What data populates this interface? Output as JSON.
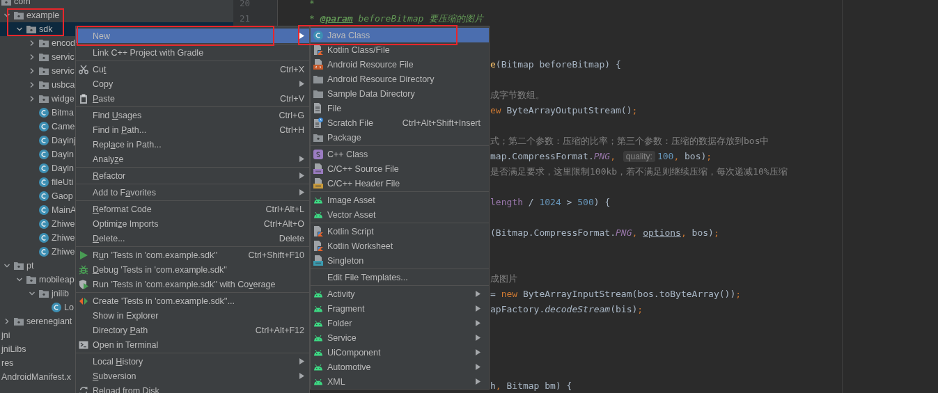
{
  "project_tree": {
    "packages": [
      {
        "label": "com",
        "kind": "package",
        "selected": false,
        "children": [
          {
            "label": "example",
            "kind": "package",
            "expanded": true,
            "selected": false,
            "outlined": true,
            "children": [
              {
                "label": "sdk",
                "kind": "package",
                "expanded": true,
                "selected": true,
                "outlined": true,
                "children": [
                  {
                    "label": "encod",
                    "kind": "package",
                    "expanded": false,
                    "selected": false
                  },
                  {
                    "label": "servic",
                    "kind": "package",
                    "expanded": false,
                    "selected": false
                  },
                  {
                    "label": "servic",
                    "kind": "package",
                    "expanded": false,
                    "selected": false
                  },
                  {
                    "label": "usbca",
                    "kind": "package",
                    "expanded": false,
                    "selected": false
                  },
                  {
                    "label": "widge",
                    "kind": "package",
                    "expanded": false,
                    "selected": false
                  },
                  {
                    "label": "Bitma",
                    "kind": "class",
                    "selected": false
                  },
                  {
                    "label": "Came",
                    "kind": "class",
                    "selected": false
                  },
                  {
                    "label": "Dayinj",
                    "kind": "class",
                    "selected": false
                  },
                  {
                    "label": "Dayin",
                    "kind": "class",
                    "selected": false
                  },
                  {
                    "label": "Dayin",
                    "kind": "class",
                    "selected": false
                  },
                  {
                    "label": "fileUti",
                    "kind": "class",
                    "selected": false
                  },
                  {
                    "label": "Gaop",
                    "kind": "class",
                    "selected": false
                  },
                  {
                    "label": "MainA",
                    "kind": "class",
                    "selected": false
                  },
                  {
                    "label": "Zhiwe",
                    "kind": "class",
                    "selected": false
                  },
                  {
                    "label": "Zhiwe",
                    "kind": "class",
                    "selected": false
                  },
                  {
                    "label": "Zhiwe",
                    "kind": "class",
                    "selected": false
                  }
                ]
              }
            ]
          },
          {
            "label": "pt",
            "kind": "package",
            "expanded": true,
            "selected": false,
            "children": [
              {
                "label": "mobileap",
                "kind": "package",
                "expanded": true,
                "selected": false,
                "children": [
                  {
                    "label": "jnilib",
                    "kind": "package",
                    "expanded": true,
                    "selected": false,
                    "children": [
                      {
                        "label": "Lo",
                        "kind": "class",
                        "selected": false
                      }
                    ]
                  }
                ]
              }
            ]
          },
          {
            "label": "serenegiant",
            "kind": "package",
            "expanded": false,
            "selected": false
          }
        ]
      }
    ],
    "module_items": [
      {
        "label": "jni",
        "selected": false
      },
      {
        "label": "jniLibs",
        "selected": false
      },
      {
        "label": "res",
        "selected": false
      },
      {
        "label": "AndroidManifest.x",
        "selected": false
      }
    ]
  },
  "editor": {
    "line_numbers": [
      "20",
      "21"
    ],
    "top_lines": [
      {
        "kind": "code",
        "tokens": [
          {
            "kind": "doc",
            "text": "*"
          }
        ]
      },
      {
        "kind": "code",
        "tokens": [
          {
            "kind": "doc",
            "text": "* "
          },
          {
            "kind": "doc-tag",
            "text": "@param"
          },
          {
            "kind": "doc",
            "text": " beforeBitmap 要压缩的图片"
          }
        ]
      }
    ],
    "lines": [
      {
        "kind": "blank"
      },
      {
        "kind": "blank"
      },
      {
        "kind": "code",
        "tokens": [
          {
            "kind": "method",
            "text": "e"
          },
          {
            "kind": "plain",
            "text": "(Bitmap beforeBitmap) {"
          }
        ]
      },
      {
        "kind": "blank"
      },
      {
        "kind": "code",
        "tokens": [
          {
            "kind": "comment",
            "text": "成字节数组。"
          }
        ]
      },
      {
        "kind": "code",
        "tokens": [
          {
            "kind": "keyword",
            "text": "ew"
          },
          {
            "kind": "plain",
            "text": " ByteArrayOutputStream()"
          },
          {
            "kind": "keyword",
            "text": ";"
          }
        ]
      },
      {
        "kind": "blank"
      },
      {
        "kind": "code",
        "tokens": [
          {
            "kind": "comment",
            "text": "式；第二个参数：压缩的比率；第三个参数：压缩的数据存放到bos中"
          }
        ]
      },
      {
        "kind": "code",
        "tokens": [
          {
            "kind": "plain",
            "text": "map.CompressFormat."
          },
          {
            "kind": "constant",
            "text": "PNG"
          },
          {
            "kind": "keyword",
            "text": ", "
          },
          {
            "kind": "hint",
            "text": "quality:"
          },
          {
            "kind": "number",
            "text": "100"
          },
          {
            "kind": "keyword",
            "text": ","
          },
          {
            "kind": "plain",
            "text": " bos)"
          },
          {
            "kind": "keyword",
            "text": ";"
          }
        ]
      },
      {
        "kind": "code",
        "tokens": [
          {
            "kind": "comment",
            "text": "是否满足要求，这里限制100kb，若不满足则继续压缩，每次递减10%压缩"
          }
        ]
      },
      {
        "kind": "blank"
      },
      {
        "kind": "code",
        "tokens": [
          {
            "kind": "field",
            "text": "length"
          },
          {
            "kind": "plain",
            "text": " / "
          },
          {
            "kind": "number",
            "text": "1024"
          },
          {
            "kind": "plain",
            "text": " > "
          },
          {
            "kind": "number",
            "text": "500"
          },
          {
            "kind": "plain",
            "text": ") {"
          }
        ]
      },
      {
        "kind": "blank"
      },
      {
        "kind": "code",
        "tokens": [
          {
            "kind": "plain",
            "text": "(Bitmap.CompressFormat."
          },
          {
            "kind": "constant",
            "text": "PNG"
          },
          {
            "kind": "keyword",
            "text": ", "
          },
          {
            "kind": "underlined",
            "text": "options"
          },
          {
            "kind": "keyword",
            "text": ","
          },
          {
            "kind": "plain",
            "text": " bos)"
          },
          {
            "kind": "keyword",
            "text": ";"
          }
        ]
      },
      {
        "kind": "blank"
      },
      {
        "kind": "blank"
      },
      {
        "kind": "code",
        "tokens": [
          {
            "kind": "comment",
            "text": "成图片"
          }
        ]
      },
      {
        "kind": "code",
        "tokens": [
          {
            "kind": "plain",
            "text": "= "
          },
          {
            "kind": "keyword",
            "text": "new"
          },
          {
            "kind": "plain",
            "text": " ByteArrayInputStream(bos.toByteArray())"
          },
          {
            "kind": "keyword",
            "text": ";"
          }
        ]
      },
      {
        "kind": "code",
        "tokens": [
          {
            "kind": "plain",
            "text": "apFactory."
          },
          {
            "kind": "static-method",
            "text": "decodeStream"
          },
          {
            "kind": "plain",
            "text": "(bis)"
          },
          {
            "kind": "keyword",
            "text": ";"
          }
        ]
      },
      {
        "kind": "blank"
      },
      {
        "kind": "blank"
      },
      {
        "kind": "blank"
      },
      {
        "kind": "blank"
      },
      {
        "kind": "code",
        "tokens": [
          {
            "kind": "plain",
            "text": "h"
          },
          {
            "kind": "keyword",
            "text": ","
          },
          {
            "kind": "plain",
            "text": " Bitmap bm) {"
          }
        ]
      }
    ]
  },
  "context_menu": {
    "items": [
      {
        "kind": "plain",
        "label": "New",
        "selected": true,
        "submenu": true,
        "outlined": true
      },
      {
        "kind": "separator"
      },
      {
        "kind": "plain",
        "label": "Link C++ Project with Gradle",
        "selected": false,
        "submenu": false
      },
      {
        "kind": "separator"
      },
      {
        "kind": "cut",
        "label": "Cu",
        "key": "t",
        "shortcut": "Ctrl+X",
        "selected": false,
        "submenu": false
      },
      {
        "kind": "plain",
        "label": "Copy",
        "selected": false,
        "submenu": true
      },
      {
        "kind": "paste",
        "key": "P",
        "after": "aste",
        "shortcut": "Ctrl+V",
        "selected": false,
        "submenu": false
      },
      {
        "kind": "separator"
      },
      {
        "kind": "plain",
        "label": "Find ",
        "key": "U",
        "after": "sages",
        "shortcut": "Ctrl+G",
        "selected": false,
        "submenu": false
      },
      {
        "kind": "plain",
        "label": "Find in ",
        "key": "P",
        "after": "ath...",
        "shortcut": "Ctrl+H",
        "selected": false,
        "submenu": false
      },
      {
        "kind": "plain",
        "label": "Repl",
        "key": "a",
        "after": "ce in Path...",
        "selected": false,
        "submenu": false
      },
      {
        "kind": "plain",
        "label": "Analy",
        "key": "z",
        "after": "e",
        "selected": false,
        "submenu": true
      },
      {
        "kind": "separator"
      },
      {
        "kind": "plain",
        "key": "R",
        "after": "efactor",
        "selected": false,
        "submenu": true
      },
      {
        "kind": "separator"
      },
      {
        "kind": "plain",
        "label": "Add to F",
        "key": "a",
        "after": "vorites",
        "selected": false,
        "submenu": true
      },
      {
        "kind": "separator"
      },
      {
        "kind": "plain",
        "key": "R",
        "after": "eformat Code",
        "shortcut": "Ctrl+Alt+L",
        "selected": false,
        "submenu": false
      },
      {
        "kind": "plain",
        "label": "Optimi",
        "key": "z",
        "after": "e Imports",
        "shortcut": "Ctrl+Alt+O",
        "selected": false,
        "submenu": false
      },
      {
        "kind": "plain",
        "key": "D",
        "after": "elete...",
        "shortcut": "Delete",
        "selected": false,
        "submenu": false
      },
      {
        "kind": "separator"
      },
      {
        "kind": "run",
        "label": "R",
        "key": "u",
        "after": "n 'Tests in 'com.example.sdk''",
        "shortcut": "Ctrl+Shift+F10",
        "selected": false,
        "submenu": false
      },
      {
        "kind": "debug",
        "key": "D",
        "after": "ebug 'Tests in 'com.example.sdk''",
        "selected": false,
        "submenu": false
      },
      {
        "kind": "coverage",
        "label": "Run 'Tests in 'com.example.sdk'' with Co",
        "key": "v",
        "after": "erage",
        "selected": false,
        "submenu": false
      },
      {
        "kind": "separator"
      },
      {
        "kind": "create-test",
        "label": "Create 'Tests in 'com.example.sdk''...",
        "selected": false,
        "submenu": false
      },
      {
        "kind": "plain",
        "label": "Show in Explorer",
        "selected": false,
        "submenu": false
      },
      {
        "kind": "plain",
        "label": "Directory ",
        "key": "P",
        "after": "ath",
        "shortcut": "Ctrl+Alt+F12",
        "selected": false,
        "submenu": false
      },
      {
        "kind": "terminal",
        "label": "Open in Terminal",
        "selected": false,
        "submenu": false
      },
      {
        "kind": "separator"
      },
      {
        "kind": "plain",
        "label": "Local ",
        "key": "H",
        "after": "istory",
        "selected": false,
        "submenu": true
      },
      {
        "kind": "plain",
        "key": "S",
        "after": "ubversion",
        "selected": false,
        "submenu": true
      },
      {
        "kind": "reload",
        "label": "Reload from Disk",
        "selected": false,
        "submenu": false
      }
    ]
  },
  "new_submenu": {
    "items": [
      {
        "kind": "java-class",
        "label": "Java Class",
        "selected": true,
        "submenu": false,
        "outlined": true
      },
      {
        "kind": "kotlin",
        "label": "Kotlin Class/File",
        "selected": false,
        "submenu": false
      },
      {
        "kind": "android-resource",
        "label": "Android Resource File",
        "selected": false,
        "submenu": false
      },
      {
        "kind": "folder",
        "label": "Android Resource Directory",
        "selected": false,
        "submenu": false
      },
      {
        "kind": "folder",
        "label": "Sample Data Directory",
        "selected": false,
        "submenu": false
      },
      {
        "kind": "file",
        "label": "File",
        "selected": false,
        "submenu": false
      },
      {
        "kind": "scratch",
        "label": "Scratch File",
        "shortcut": "Ctrl+Alt+Shift+Insert",
        "selected": false,
        "submenu": false
      },
      {
        "kind": "package",
        "label": "Package",
        "selected": false,
        "submenu": false
      },
      {
        "kind": "separator"
      },
      {
        "kind": "cpp-class",
        "label": "C++ Class",
        "selected": false,
        "submenu": false
      },
      {
        "kind": "cpp-source",
        "label": "C/C++ Source File",
        "selected": false,
        "submenu": false
      },
      {
        "kind": "cpp-header",
        "label": "C/C++ Header File",
        "selected": false,
        "submenu": false
      },
      {
        "kind": "separator"
      },
      {
        "kind": "android",
        "label": "Image Asset",
        "selected": false,
        "submenu": false
      },
      {
        "kind": "android",
        "label": "Vector Asset",
        "selected": false,
        "submenu": false
      },
      {
        "kind": "separator"
      },
      {
        "kind": "kotlin",
        "label": "Kotlin Script",
        "selected": false,
        "submenu": false
      },
      {
        "kind": "kotlin",
        "label": "Kotlin Worksheet",
        "selected": false,
        "submenu": false
      },
      {
        "kind": "singleton",
        "label": "Singleton",
        "selected": false,
        "submenu": false
      },
      {
        "kind": "separator"
      },
      {
        "kind": "plain",
        "label": "Edit File Templates...",
        "selected": false,
        "submenu": false
      },
      {
        "kind": "separator"
      },
      {
        "kind": "android",
        "label": "Activity",
        "selected": false,
        "submenu": true
      },
      {
        "kind": "android",
        "label": "Fragment",
        "selected": false,
        "submenu": true
      },
      {
        "kind": "android",
        "label": "Folder",
        "selected": false,
        "submenu": true
      },
      {
        "kind": "android",
        "label": "Service",
        "selected": false,
        "submenu": true
      },
      {
        "kind": "android",
        "label": "UiComponent",
        "selected": false,
        "submenu": true
      },
      {
        "kind": "android",
        "label": "Automotive",
        "selected": false,
        "submenu": true
      },
      {
        "kind": "android",
        "label": "XML",
        "selected": false,
        "submenu": true
      }
    ]
  }
}
